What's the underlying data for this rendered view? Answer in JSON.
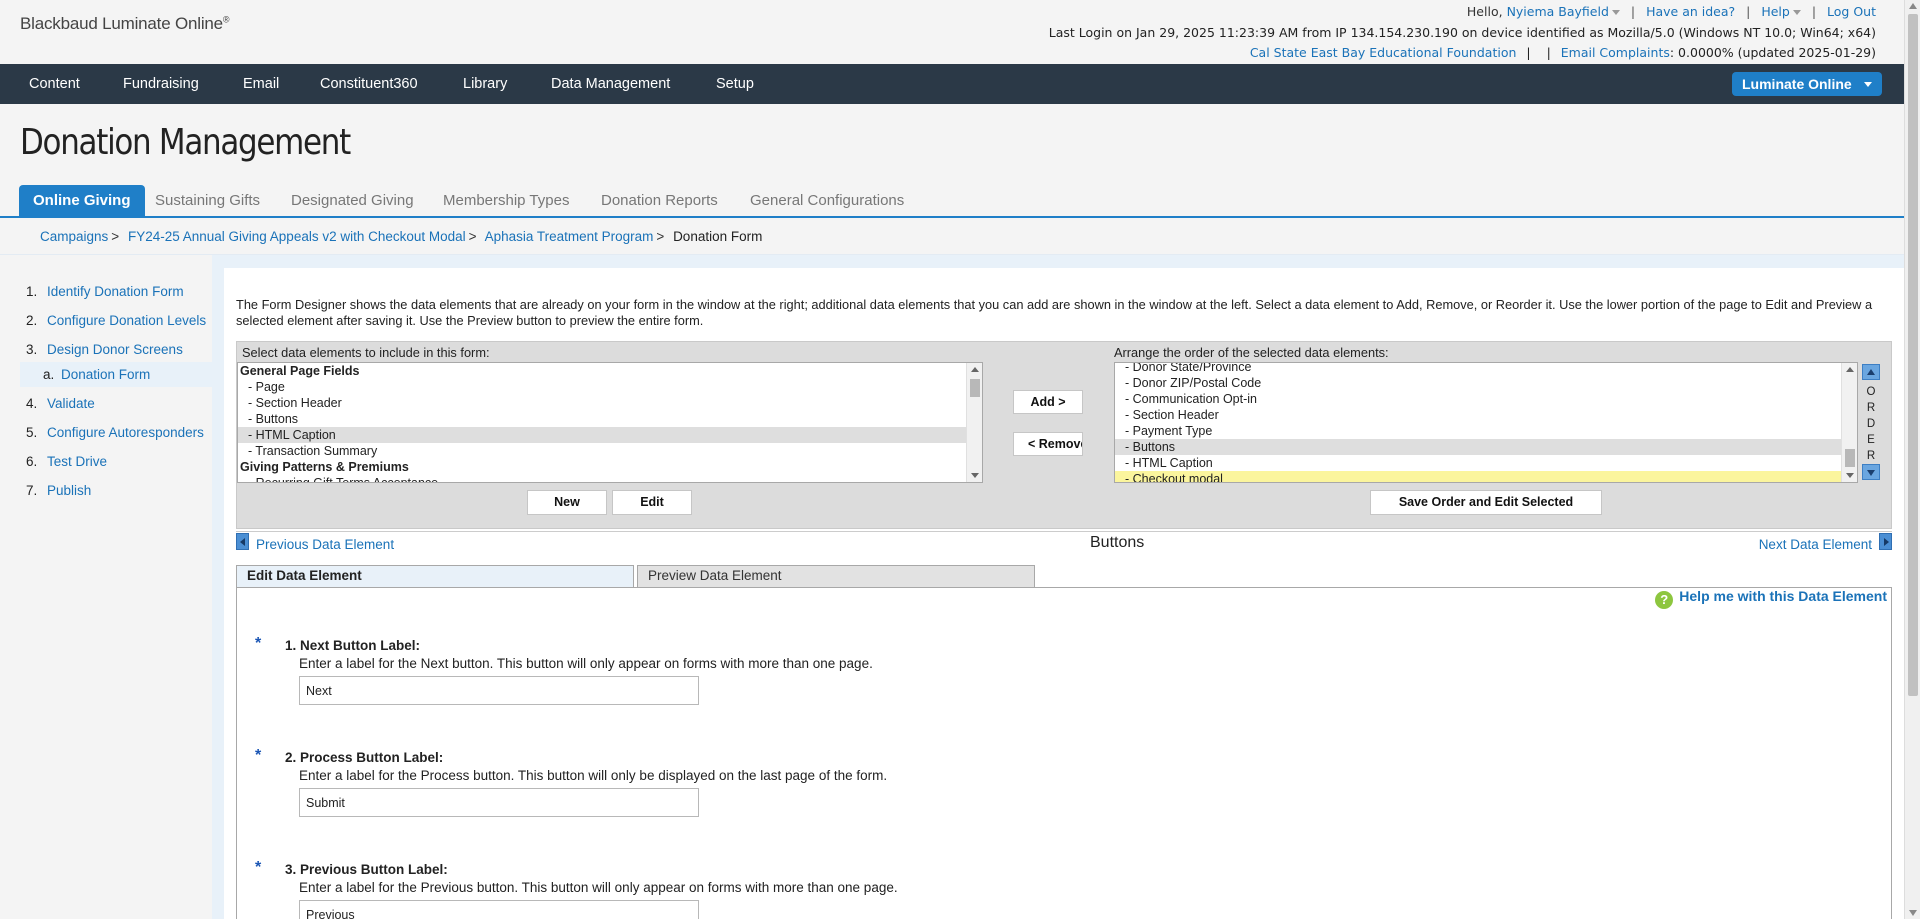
{
  "app": {
    "logo": "Blackbaud Luminate Online",
    "logo_mark": "®"
  },
  "utility": {
    "hello_prefix": "Hello,",
    "user_name": "Nyiema Bayfield",
    "have_idea": "Have an idea?",
    "help": "Help",
    "logout": "Log Out",
    "last_login": "Last Login on Jan 29, 2025 11:23:39 AM from IP 134.154.230.190 on device identified as Mozilla/5.0 (Windows NT 10.0; Win64; x64)",
    "org_name": "Cal State East Bay Educational Foundation",
    "email_complaints_label": "Email Complaints",
    "email_complaints_value": ": 0.0000% (updated 2025-01-29)"
  },
  "nav": {
    "items": [
      "Content",
      "Fundraising",
      "Email",
      "Constituent360",
      "Library",
      "Data Management",
      "Setup"
    ],
    "product_button": "Luminate Online"
  },
  "page": {
    "title": "Donation Management"
  },
  "tabs": [
    "Online Giving",
    "Sustaining Gifts",
    "Designated Giving",
    "Membership Types",
    "Donation Reports",
    "General Configurations"
  ],
  "breadcrumb": {
    "items": [
      "Campaigns",
      "FY24-25 Annual Giving Appeals v2 with Checkout Modal",
      "Aphasia Treatment Program"
    ],
    "current": "Donation Form",
    "separator": ">"
  },
  "steps": [
    {
      "num": "1.",
      "label": "Identify Donation Form"
    },
    {
      "num": "2.",
      "label": "Configure Donation Levels"
    },
    {
      "num": "3.",
      "label": "Design Donor Screens"
    },
    {
      "num": "4.",
      "label": "Validate"
    },
    {
      "num": "5.",
      "label": "Configure Autoresponders"
    },
    {
      "num": "6.",
      "label": "Test Drive"
    },
    {
      "num": "7.",
      "label": "Publish"
    }
  ],
  "substep": {
    "num": "a.",
    "label": "Donation Form"
  },
  "intro_text": "The Form Designer shows the data elements that are already on your form in the window at the right; additional data elements that you can add are shown in the window at the left. Select a data element to Add, Remove, or Reorder it. Use the lower portion of the page to Edit and Preview a selected element after saving it. Use the Preview button to preview the entire form.",
  "designer": {
    "left_label": "Select data elements to include in this form:",
    "right_label": "Arrange the order of the selected data elements:",
    "available": [
      {
        "text": "General Page Fields",
        "kind": "grp"
      },
      {
        "text": "- Page",
        "kind": "ind"
      },
      {
        "text": "- Section Header",
        "kind": "ind"
      },
      {
        "text": "- Buttons",
        "kind": "ind"
      },
      {
        "text": "- HTML Caption",
        "kind": "ind sel"
      },
      {
        "text": "- Transaction Summary",
        "kind": "ind"
      },
      {
        "text": "Giving Patterns & Premiums",
        "kind": "grp"
      },
      {
        "text": "- Recurring Gift Terms Acceptance",
        "kind": "ind"
      }
    ],
    "selected": [
      {
        "text": "- Donor State/Province",
        "kind": "ind"
      },
      {
        "text": "- Donor ZIP/Postal Code",
        "kind": "ind"
      },
      {
        "text": "- Communication Opt-in",
        "kind": "ind"
      },
      {
        "text": "- Section Header",
        "kind": "ind"
      },
      {
        "text": "- Payment Type",
        "kind": "ind"
      },
      {
        "text": "- Buttons",
        "kind": "ind sel"
      },
      {
        "text": "- HTML Caption",
        "kind": "ind"
      },
      {
        "text": "- Checkout modal",
        "kind": "ind hl"
      }
    ],
    "add_button": "Add >",
    "remove_button": "< Remove",
    "new_button": "New",
    "edit_button": "Edit",
    "save_order_button": "Save Order and Edit Selected",
    "order_letters": [
      "O",
      "R",
      "D",
      "E",
      "R"
    ]
  },
  "element_nav": {
    "prev": "Previous Data Element",
    "next": "Next Data Element",
    "current": "Buttons"
  },
  "subtabs": {
    "edit": "Edit Data Element",
    "preview": "Preview Data Element"
  },
  "help_link": "Help me with this Data Element",
  "fields": [
    {
      "label": "1. Next Button Label:",
      "desc": "Enter a label for the Next button. This button will only appear on forms with more than one page.",
      "value": "Next"
    },
    {
      "label": "2. Process Button Label:",
      "desc": "Enter a label for the Process button. This button will only be displayed on the last page of the form.",
      "value": "Submit"
    },
    {
      "label": "3. Previous Button Label:",
      "desc": "Enter a label for the Previous button. This button will only appear on forms with more than one page.",
      "value": "Previous"
    }
  ],
  "required_marker": "*"
}
